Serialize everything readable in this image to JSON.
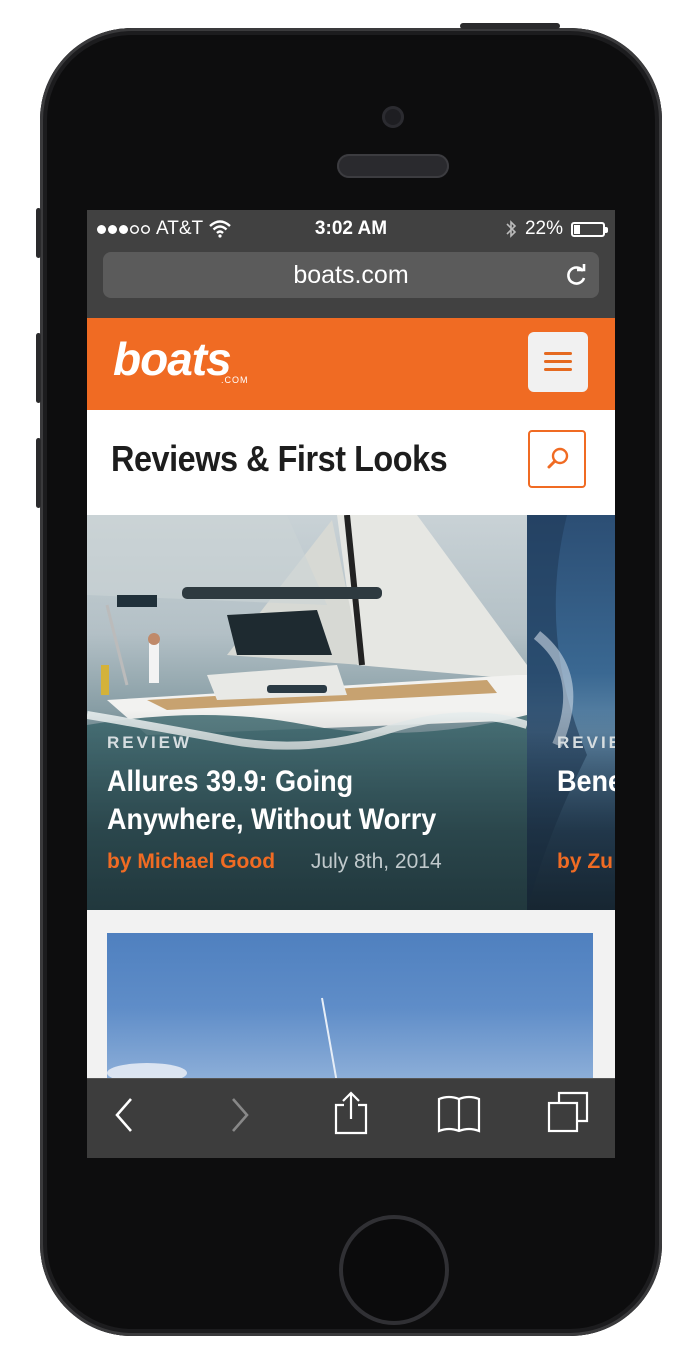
{
  "status_bar": {
    "carrier": "AT&T",
    "time": "3:02 AM",
    "battery": "22%",
    "battery_level": 0.22,
    "signal_bars_filled": 3,
    "signal_bars_total": 5
  },
  "browser": {
    "url": "boats.com"
  },
  "site": {
    "logo_text": "boats",
    "logo_suffix": ".COM",
    "brand_color": "#f06b23"
  },
  "page": {
    "section_title": "Reviews & First Looks"
  },
  "carousel": {
    "cards": [
      {
        "tag": "REVIEW",
        "title": "Allures 39.9: Going Anywhere, Without Worry",
        "author": "by Michael Good",
        "date": "July 8th, 2014"
      },
      {
        "tag": "REVIE",
        "title": "Bene Innov",
        "author": "by Zu",
        "date": ""
      }
    ]
  },
  "icons": {
    "wifi": "wifi-icon",
    "bluetooth": "bluetooth-icon",
    "reload": "reload-icon",
    "menu": "hamburger-menu-icon",
    "search": "search-icon",
    "back": "back-arrow-icon",
    "forward": "forward-arrow-icon",
    "share": "share-icon",
    "bookmarks": "bookmarks-icon",
    "tabs": "tabs-icon"
  }
}
